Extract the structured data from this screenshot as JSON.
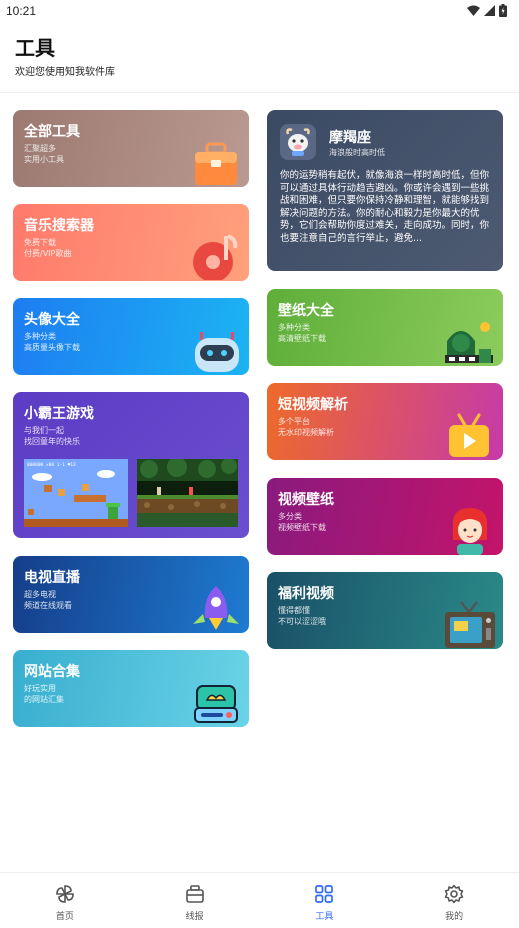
{
  "status_bar": {
    "time": "10:21"
  },
  "header": {
    "title": "工具",
    "subtitle": "欢迎您使用知我软件库"
  },
  "cards": {
    "all_tools": {
      "title": "全部工具",
      "desc_line1": "汇聚超多",
      "desc_line2": "实用小工具"
    },
    "music": {
      "title": "音乐搜索器",
      "desc_line1": "免费下载",
      "desc_line2": "付费/VIP歌曲"
    },
    "avatar": {
      "title": "头像大全",
      "desc_line1": "多种分类",
      "desc_line2": "高质量头像下载"
    },
    "nes": {
      "title": "小霸王游戏",
      "desc_line1": "与我们一起",
      "desc_line2": "找回童年的快乐",
      "game1_score": "000000 ✕00 1-1 ♥13"
    },
    "tv": {
      "title": "电视直播",
      "desc_line1": "超多电视",
      "desc_line2": "频道在线观看"
    },
    "sites": {
      "title": "网站合集",
      "desc_line1": "好玩实用",
      "desc_line2": "的网站汇集"
    },
    "horoscope": {
      "title": "摩羯座",
      "subtitle": "海浪般时高时低",
      "text": "你的运势稍有起伏，就像海浪一样时高时低，但你可以通过具体行动趋吉避凶。你或许会遇到一些挑战和困难，但只要你保持冷静和理智，就能够找到解决问题的方法。你的耐心和毅力是你最大的优势，它们会帮助你度过难关，走向成功。同时，你也要注意自己的言行举止，避免..."
    },
    "wallpaper": {
      "title": "壁纸大全",
      "desc_line1": "多种分类",
      "desc_line2": "高清壁纸下载"
    },
    "short_video": {
      "title": "短视频解析",
      "desc_line1": "多个平台",
      "desc_line2": "无水印视频解析"
    },
    "video_wallpaper": {
      "title": "视频壁纸",
      "desc_line1": "多分类",
      "desc_line2": "视频壁纸下载"
    },
    "welfare_video": {
      "title": "福利视频",
      "desc_line1": "懂得都懂",
      "desc_line2": "不可以涩涩哦"
    }
  },
  "nav": {
    "items": [
      {
        "label": "首页",
        "icon": "pinwheel-icon"
      },
      {
        "label": "线报",
        "icon": "briefcase-icon"
      },
      {
        "label": "工具",
        "icon": "grid-icon"
      },
      {
        "label": "我的",
        "icon": "gear-icon"
      }
    ],
    "active_index": 2,
    "active_color": "#2f6bff"
  }
}
